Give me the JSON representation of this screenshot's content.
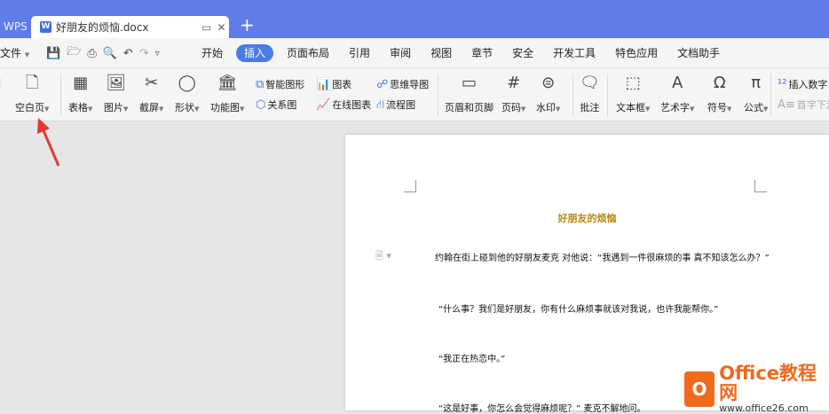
{
  "tabbar": {
    "app_label": "WPS",
    "doc_icon": "W",
    "doc_title": "好朋友的烦恼.docx",
    "new_tab": "+"
  },
  "menubar": {
    "file": "文件",
    "items": [
      "开始",
      "插入",
      "页面布局",
      "引用",
      "审阅",
      "视图",
      "章节",
      "安全",
      "开发工具",
      "特色应用",
      "文档助手"
    ],
    "active_index": 1
  },
  "ribbon": {
    "blank_page": "空白页",
    "table": "表格",
    "picture": "图片",
    "screenshot": "截屏",
    "shape": "形状",
    "function_chart": "功能图",
    "smart_graphic": "智能图形",
    "chart": "图表",
    "mind_map": "思维导图",
    "relation_chart": "关系图",
    "online_chart": "在线图表",
    "flow_chart": "流程图",
    "header_footer": "页眉和页脚",
    "page_number": "页码",
    "watermark": "水印",
    "comment": "批注",
    "text_box": "文本框",
    "art_text": "艺术字",
    "symbol": "符号",
    "formula": "公式",
    "insert_number": "插入数字",
    "drop_cap": "首字下沉"
  },
  "document": {
    "title": "好朋友的烦恼",
    "paragraphs": [
      "约翰在街上碰到他的好朋友麦克 对他说：“我遇到一件很麻烦的事 真不知该怎么办？”",
      "“什么事？我们是好朋友，你有什么麻烦事就该对我说，也许我能帮你。”",
      "“我正在热恋中。”",
      "“这是好事，你怎么会觉得麻烦呢？” 麦克不解地问。"
    ]
  },
  "watermark": {
    "logo": "O",
    "line1": "Office教程网",
    "line2": "www.office26.com"
  },
  "colors": {
    "tabbar": "#5f7ce8",
    "accent": "#4b7be5",
    "title": "#b8860b",
    "arrow": "#e53935",
    "brand": "#f06a1d"
  }
}
